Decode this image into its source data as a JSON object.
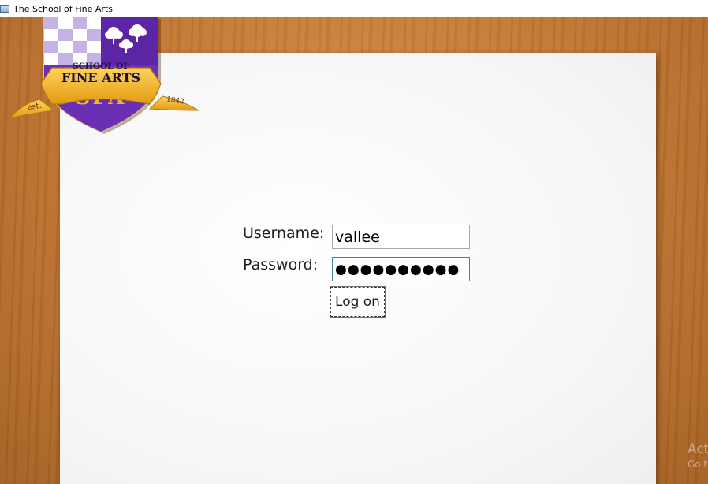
{
  "window": {
    "title": "The School of Fine Arts",
    "icon": "app-window-icon"
  },
  "logo": {
    "line1": "SCHOOL OF",
    "line2": "FINE ARTS",
    "monogram": "SFA",
    "est_label": "est.",
    "year": "1842",
    "colors": {
      "purple": "#6a2fb5",
      "gold": "#f1b52a",
      "white_check": "#ffffff",
      "lavender_check": "#c6b3e6"
    }
  },
  "login": {
    "username_label": "Username:",
    "username_value": "vallee",
    "password_label": "Password:",
    "password_value": "●●●●●●●●●●",
    "logon_button": "Log on"
  },
  "watermark": {
    "line1": "Act",
    "line2": "Go t"
  },
  "colors": {
    "desk_wood": "#c07634",
    "paper": "#f7f7f7",
    "focus_border": "#3c7fb1"
  }
}
